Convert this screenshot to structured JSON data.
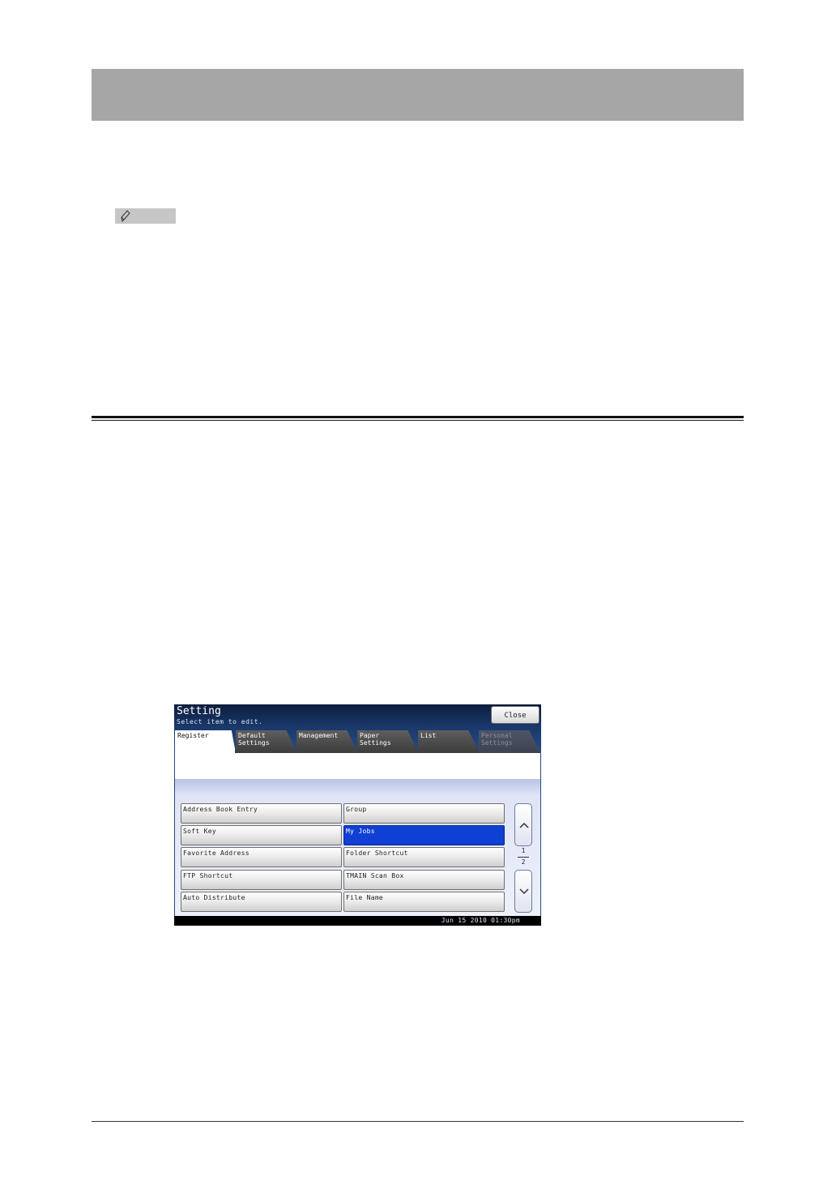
{
  "panel": {
    "title": "Setting",
    "subtitle": "Select item to edit.",
    "close_label": "Close",
    "tabs": [
      {
        "label": "Register"
      },
      {
        "label": "Default\nSettings"
      },
      {
        "label": "Management"
      },
      {
        "label": "Paper\nSettings"
      },
      {
        "label": "List"
      },
      {
        "label": "Personal\nSettings"
      }
    ],
    "items": [
      {
        "label": "Address Book Entry"
      },
      {
        "label": "Group"
      },
      {
        "label": "Soft Key"
      },
      {
        "label": "My Jobs"
      },
      {
        "label": "Favorite Address"
      },
      {
        "label": "Folder Shortcut"
      },
      {
        "label": "FTP Shortcut"
      },
      {
        "label": "TMAIN Scan Box"
      },
      {
        "label": "Auto Distribute"
      },
      {
        "label": "File Name"
      }
    ],
    "selected_item": "My Jobs",
    "page_current": "1",
    "page_total": "2",
    "datetime": "Jun 15 2010 01:30pm",
    "icons": {
      "up": "chevron-up-icon",
      "down": "chevron-down-icon",
      "note": "pencil-icon"
    },
    "colors": {
      "selected": "#0f3fd3",
      "header_band": "#a6a6a6"
    }
  }
}
